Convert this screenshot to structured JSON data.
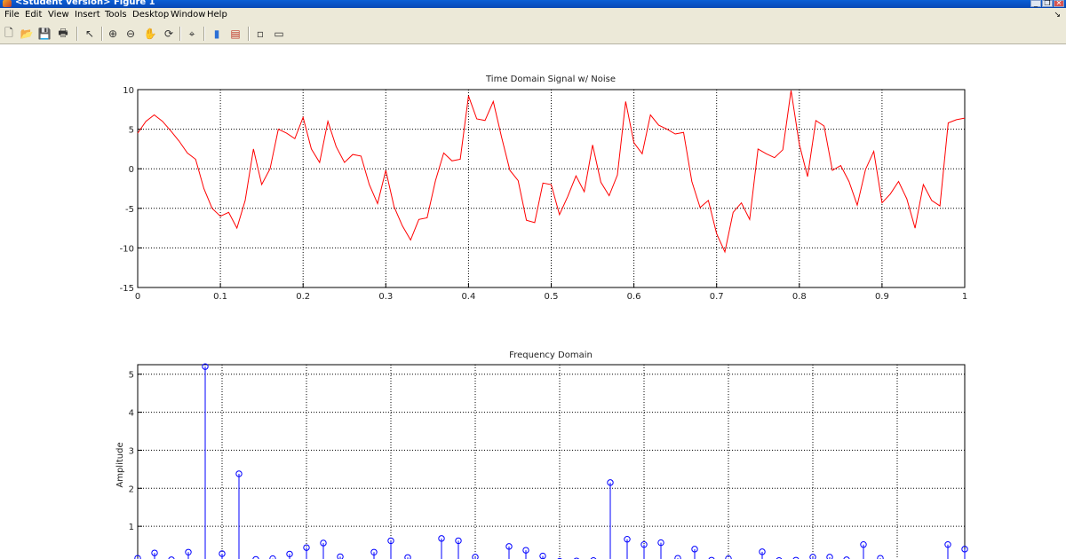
{
  "window": {
    "title": "<Student Version> Figure 1",
    "controls": {
      "minimize": "_",
      "restore": "❐",
      "close": "✕"
    }
  },
  "menu": {
    "items": [
      "File",
      "Edit",
      "View",
      "Insert",
      "Tools",
      "Desktop",
      "Window",
      "Help"
    ],
    "overflow": "↘"
  },
  "toolbar": {
    "buttons": [
      {
        "icon": "new-figure-icon",
        "glyph": "🗋"
      },
      {
        "icon": "open-file-icon",
        "glyph": "📂"
      },
      {
        "icon": "save-icon",
        "glyph": "💾"
      },
      {
        "icon": "print-icon",
        "glyph": "🖶"
      },
      {
        "icon": "pointer-icon",
        "glyph": "↖"
      },
      {
        "icon": "zoom-in-icon",
        "glyph": "⊕"
      },
      {
        "icon": "zoom-out-icon",
        "glyph": "⊖"
      },
      {
        "icon": "pan-hand-icon",
        "glyph": "✋"
      },
      {
        "icon": "rotate-3d-icon",
        "glyph": "⟳"
      },
      {
        "icon": "data-cursor-icon",
        "glyph": "⌖"
      },
      {
        "icon": "colorbar-icon",
        "glyph": "▮"
      },
      {
        "icon": "legend-icon",
        "glyph": "▤"
      },
      {
        "icon": "hide-plot-tools-icon",
        "glyph": "▫"
      },
      {
        "icon": "show-plot-tools-icon",
        "glyph": "▭"
      }
    ]
  },
  "colors": {
    "signal": "#ff0000",
    "stem": "#0000ff",
    "grid": "#000000"
  },
  "chart_data": [
    {
      "type": "line",
      "title": "Time Domain Signal w/ Noise",
      "xlabel": "",
      "ylabel": "",
      "xlim": [
        0,
        1
      ],
      "ylim": [
        -15,
        10
      ],
      "xticks": [
        "0",
        "0.1",
        "0.2",
        "0.3",
        "0.4",
        "0.5",
        "0.6",
        "0.7",
        "0.8",
        "0.9",
        "1"
      ],
      "yticks": [
        "10",
        "5",
        "0",
        "-5",
        "-10",
        "-15"
      ],
      "grid": true,
      "series": [
        {
          "color": "#ff0000",
          "x": [
            0,
            0.01,
            0.02,
            0.03,
            0.04,
            0.05,
            0.06,
            0.07,
            0.08,
            0.09,
            0.1,
            0.11,
            0.12,
            0.13,
            0.14,
            0.15,
            0.16,
            0.17,
            0.18,
            0.19,
            0.2,
            0.21,
            0.22,
            0.23,
            0.24,
            0.25,
            0.26,
            0.27,
            0.28,
            0.29,
            0.3,
            0.31,
            0.32,
            0.33,
            0.34,
            0.35,
            0.36,
            0.37,
            0.38,
            0.39,
            0.4,
            0.41,
            0.42,
            0.43,
            0.44,
            0.45,
            0.46,
            0.47,
            0.48,
            0.49,
            0.5,
            0.51,
            0.52,
            0.53,
            0.54,
            0.55,
            0.56,
            0.57,
            0.58,
            0.59,
            0.6,
            0.61,
            0.62,
            0.63,
            0.64,
            0.65,
            0.66,
            0.67,
            0.68,
            0.69,
            0.7,
            0.71,
            0.72,
            0.73,
            0.74,
            0.75,
            0.76,
            0.77,
            0.78,
            0.79,
            0.8,
            0.81,
            0.82,
            0.83,
            0.84,
            0.85,
            0.86,
            0.87,
            0.88,
            0.89,
            0.9,
            0.91,
            0.92,
            0.93,
            0.94,
            0.95,
            0.96,
            0.97,
            0.98,
            0.99,
            1
          ],
          "y": [
            4.5,
            6,
            6.8,
            6,
            4.8,
            3.5,
            2,
            1.2,
            -2.5,
            -5,
            -6,
            -5.5,
            -7.5,
            -4,
            2.5,
            -2,
            0,
            5,
            4.5,
            3.8,
            6.5,
            2.5,
            0.8,
            6,
            2.8,
            0.8,
            1.8,
            1.6,
            -2,
            -4.4,
            -0.2,
            -4.8,
            -7.2,
            -9,
            -6.4,
            -6.2,
            -1.5,
            2,
            1,
            1.2,
            9.2,
            6.3,
            6.1,
            8.5,
            4,
            -0.2,
            -1.5,
            -6.5,
            -6.8,
            -1.8,
            -2,
            -5.8,
            -3.5,
            -0.9,
            -2.9,
            3,
            -1.7,
            -3.4,
            -0.8,
            8.5,
            3.3,
            1.9,
            6.8,
            5.5,
            5,
            4.4,
            4.6,
            -1.6,
            -4.9,
            -4,
            -8.2,
            -10.5,
            -5.5,
            -4.3,
            -6.4,
            2.5,
            1.9,
            1.4,
            2.4,
            9.9,
            3.1,
            -1,
            6.1,
            5.4,
            -0.2,
            0.4,
            -1.6,
            -4.6,
            -0.1,
            2.2,
            -4.3,
            -3.2,
            -1.6,
            -3.8,
            -7.5,
            -2,
            -4,
            -4.7,
            5.8,
            6.2,
            6.4
          ]
        }
      ]
    },
    {
      "type": "stem",
      "title": "Frequency Domain",
      "xlabel": "",
      "ylabel": "Amplitude",
      "xlim": [
        0,
        49
      ],
      "ylim": [
        0,
        5.25
      ],
      "yticks": [
        "5",
        "4",
        "3",
        "2",
        "1"
      ],
      "grid": true,
      "series": [
        {
          "color": "#0000ff",
          "x": [
            0,
            1,
            2,
            3,
            4,
            5,
            6,
            7,
            8,
            9,
            10,
            11,
            12,
            13,
            14,
            15,
            16,
            17,
            18,
            19,
            20,
            21,
            22,
            23,
            24,
            25,
            26,
            27,
            28,
            29,
            30,
            31,
            32,
            33,
            34,
            35,
            36,
            37,
            38,
            39,
            40,
            41,
            42,
            43,
            44,
            45,
            46,
            47,
            48,
            49
          ],
          "values": [
            0.16,
            0.3,
            0.12,
            0.32,
            5.2,
            0.28,
            2.38,
            0.13,
            0.15,
            0.27,
            0.44,
            0.56,
            0.2,
            0.05,
            0.32,
            0.62,
            0.18,
            0.04,
            0.68,
            0.62,
            0.19,
            0.02,
            0.47,
            0.37,
            0.22,
            0.08,
            0.09,
            0.1,
            2.15,
            0.66,
            0.52,
            0.57,
            0.16,
            0.4,
            0.11,
            0.15,
            0.03,
            0.33,
            0.1,
            0.11,
            0.19,
            0.19,
            0.12,
            0.52,
            0.16,
            0.03,
            0.03,
            0.02,
            0.52,
            0.4
          ]
        }
      ]
    }
  ]
}
